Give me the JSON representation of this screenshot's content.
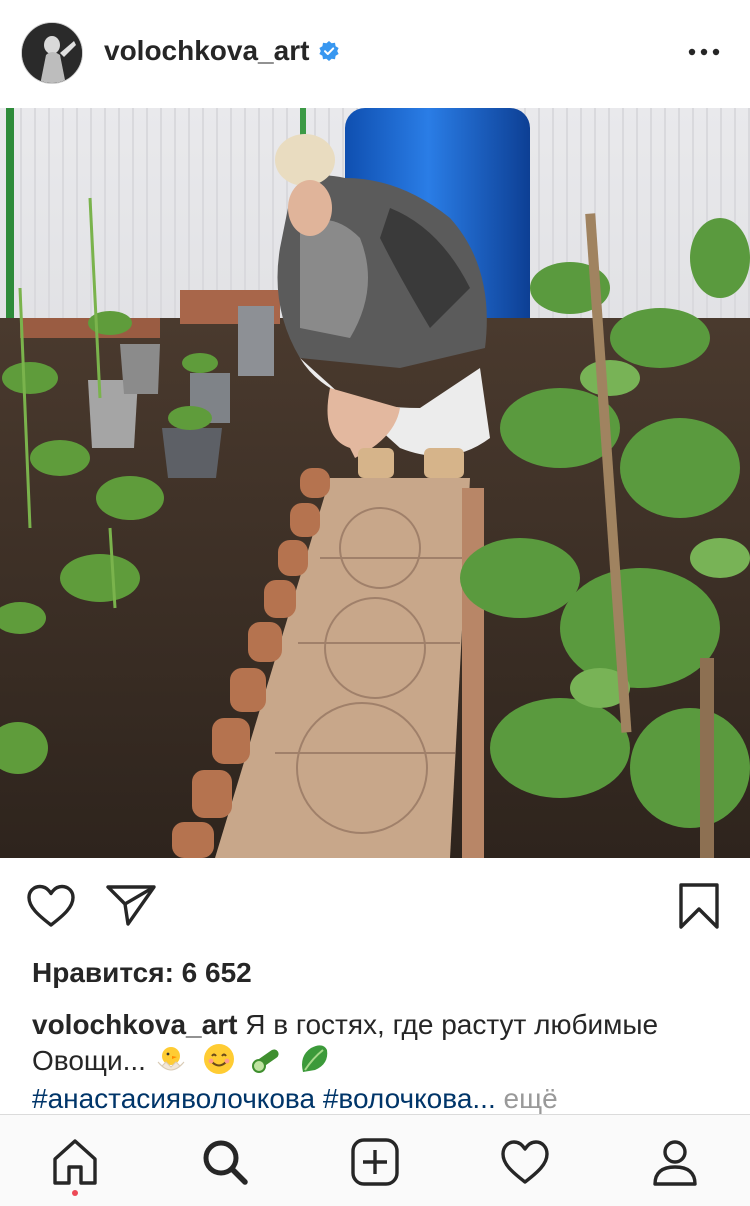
{
  "header": {
    "username": "volochkova_art",
    "verified": true
  },
  "post": {
    "photo_description": "greenhouse garden with vegetables",
    "likes_label": "Нравится: 6 652",
    "caption": {
      "username": "volochkova_art",
      "text": "Я в гостях, где растут любимые Овощи..."
    },
    "hashtags": "#анастасияволочкова #волочкова...",
    "more_label": "ещё"
  },
  "colors": {
    "verified": "#3897f0",
    "hashtag": "#003569",
    "notification_dot": "#ed4956"
  },
  "icons": {
    "like": "heart-outline-icon",
    "share": "paper-plane-icon",
    "save": "bookmark-icon",
    "home": "home-icon",
    "search": "search-icon",
    "add": "plus-square-icon",
    "activity": "heart-outline-icon",
    "profile": "person-icon"
  }
}
